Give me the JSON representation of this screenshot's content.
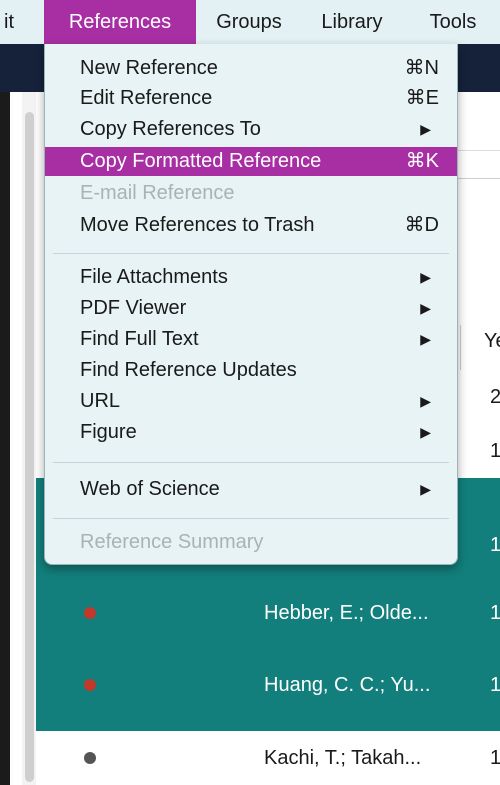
{
  "menubar": {
    "items": [
      "it",
      "References",
      "Groups",
      "Library",
      "Tools"
    ],
    "active_index": 1
  },
  "column_header": "Ye",
  "rows": [
    {
      "author": "",
      "year": "2",
      "selected": false,
      "dot": "none"
    },
    {
      "author": "",
      "year": "1",
      "selected": false,
      "dot": "none"
    },
    {
      "author": "",
      "year": "1",
      "selected": true,
      "dot": "none"
    },
    {
      "author": "Hebber, E.; Olde...",
      "year": "1",
      "selected": true,
      "dot": "#c0392b"
    },
    {
      "author": "Huang, C. C.; Yu...",
      "year": "1",
      "selected": true,
      "dot": "#c0392b"
    },
    {
      "author": "Kachi, T.; Takah...",
      "year": "1",
      "selected": false,
      "dot": "#555555"
    }
  ],
  "menu": {
    "groups": [
      [
        {
          "label": "New Reference",
          "shortcut": "⌘N"
        },
        {
          "label": "Edit Reference",
          "shortcut": "⌘E"
        },
        {
          "label": "Copy References To",
          "submenu": true
        },
        {
          "label": "Copy Formatted Reference",
          "shortcut": "⌘K",
          "highlighted": true
        },
        {
          "label": "E-mail Reference",
          "disabled": true
        },
        {
          "label": "Move References to Trash",
          "shortcut": "⌘D"
        }
      ],
      [
        {
          "label": "File Attachments",
          "submenu": true
        },
        {
          "label": "PDF Viewer",
          "submenu": true
        },
        {
          "label": "Find Full Text",
          "submenu": true
        },
        {
          "label": "Find Reference Updates"
        },
        {
          "label": "URL",
          "submenu": true
        },
        {
          "label": "Figure",
          "submenu": true
        }
      ],
      [
        {
          "label": "Web of Science",
          "submenu": true
        }
      ],
      [
        {
          "label": "Reference Summary",
          "disabled": true
        }
      ]
    ],
    "submenu_arrow": "▶",
    "colors": {
      "highlight": "#a82fa3",
      "disabled_text": "#a9b3b5",
      "menu_bg": "#e7f3f5",
      "selection_row": "#127f7c"
    }
  }
}
